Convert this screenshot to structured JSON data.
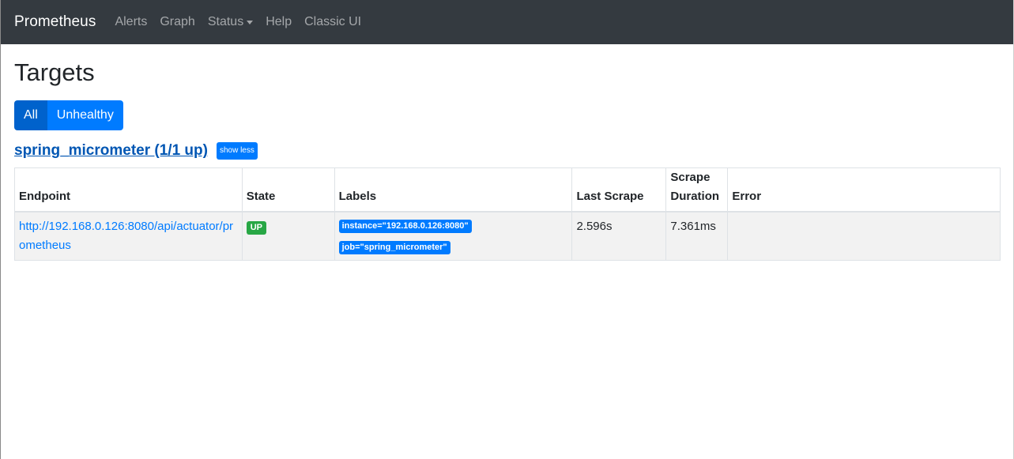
{
  "nav": {
    "brand": "Prometheus",
    "items": [
      "Alerts",
      "Graph",
      "Status",
      "Help",
      "Classic UI"
    ]
  },
  "page": {
    "title": "Targets",
    "filters": [
      "All",
      "Unhealthy"
    ]
  },
  "job": {
    "name": "spring_micrometer (1/1 up)",
    "toggle": "show less"
  },
  "table": {
    "headers": [
      "Endpoint",
      "State",
      "Labels",
      "Last Scrape",
      "Scrape\nDuration",
      "Error"
    ],
    "rows": [
      {
        "endpoint": "http://192.168.0.126:8080/api/actuator/prometheus",
        "state": "UP",
        "labels": [
          "instance=\"192.168.0.126:8080\"",
          "job=\"spring_micrometer\""
        ],
        "last_scrape": "2.596s",
        "scrape_duration": "7.361ms",
        "error": ""
      }
    ]
  },
  "colors": {
    "navbar": "#343a40",
    "primary": "#007bff",
    "primary_active": "#0062cc",
    "success": "#28a745",
    "link": "#0056b3"
  }
}
